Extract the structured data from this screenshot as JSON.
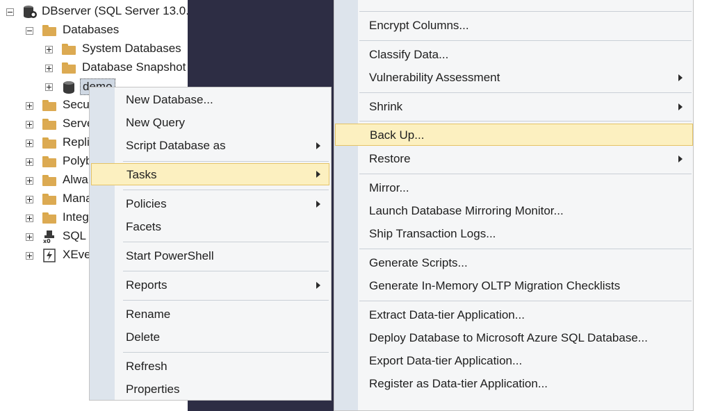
{
  "tree": {
    "server": "DBserver (SQL Server 13.0.",
    "databases": "Databases",
    "system_databases": "System Databases",
    "database_snapshots": "Database Snapshot",
    "selected_db": "demo",
    "security": "Secu",
    "server_objects": "Serve",
    "replication": "Repli",
    "polybase": "Polyb",
    "always_on": "Alwa",
    "management": "Mana",
    "integration": "Integ",
    "sql_agent": "SQL",
    "xevent": "XEve"
  },
  "context_menu": {
    "new_database": "New Database...",
    "new_query": "New Query",
    "script_database_as": "Script Database as",
    "tasks": "Tasks",
    "policies": "Policies",
    "facets": "Facets",
    "start_powershell": "Start PowerShell",
    "reports": "Reports",
    "rename": "Rename",
    "delete": "Delete",
    "refresh": "Refresh",
    "properties": "Properties"
  },
  "tasks_menu": {
    "encrypt_columns": "Encrypt Columns...",
    "classify_data": "Classify Data...",
    "vulnerability_assessment": "Vulnerability Assessment",
    "shrink": "Shrink",
    "back_up": "Back Up...",
    "restore": "Restore",
    "mirror": "Mirror...",
    "launch_mirroring_monitor": "Launch Database Mirroring Monitor...",
    "ship_transaction_logs": "Ship Transaction Logs...",
    "generate_scripts": "Generate Scripts...",
    "generate_inmemory_checklists": "Generate In-Memory OLTP Migration Checklists",
    "extract_data_tier": "Extract Data-tier Application...",
    "deploy_to_azure": "Deploy Database to Microsoft Azure SQL Database...",
    "export_data_tier": "Export Data-tier Application...",
    "register_data_tier": "Register as Data-tier Application..."
  },
  "colors": {
    "highlight_bg": "#fcf0c0",
    "highlight_border": "#e5c365",
    "gutter": "#dde4ec",
    "dark_background": "#2d2d44"
  }
}
